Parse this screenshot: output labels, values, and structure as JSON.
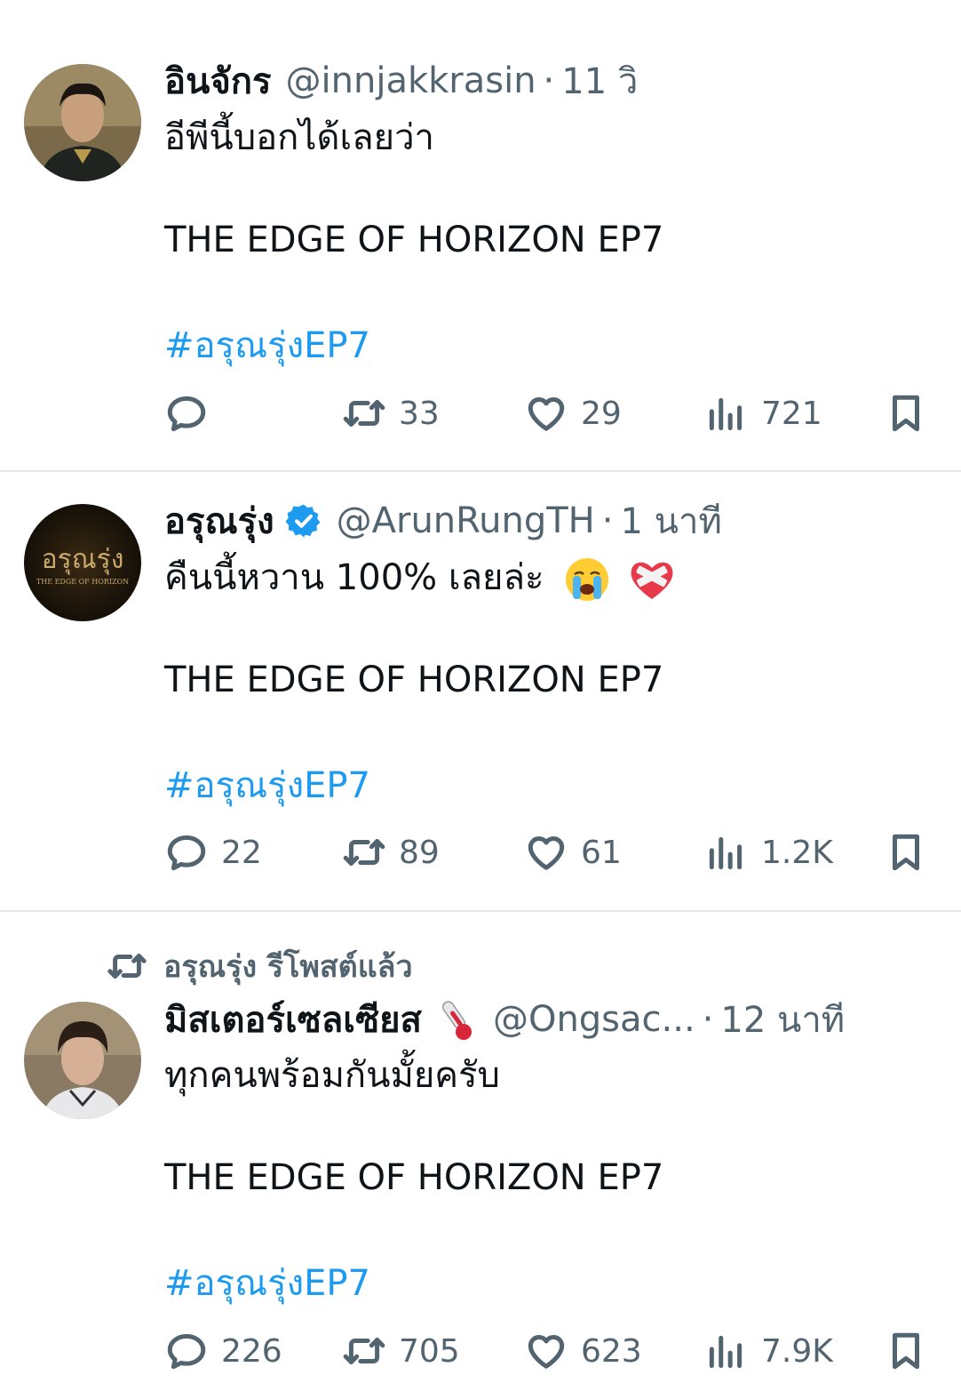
{
  "tweets": [
    {
      "name": "อินจักร",
      "handle": "@innjakkrasin",
      "time": "11 วิ",
      "text1": "อีพีนี้บอกได้เลยว่า",
      "title": "THE EDGE OF HORIZON EP7",
      "hashtag": "#อรุณรุ่งEP7",
      "replies": "",
      "reposts": "33",
      "likes": "29",
      "views": "721"
    },
    {
      "name": "อรุณรุ่ง",
      "verified": true,
      "handle": "@ArunRungTH",
      "time": "1 นาที",
      "text1": "คืนนี้หวาน 100% เลยล่ะ",
      "emoji": [
        "crying-face-emoji",
        "mending-heart-emoji"
      ],
      "title": "THE EDGE OF HORIZON EP7",
      "hashtag": "#อรุณรุ่งEP7",
      "avatar_logo_text": "อรุณรุ่ง",
      "avatar_logo_sub": "THE EDGE OF HORIZON",
      "replies": "22",
      "reposts": "89",
      "likes": "61",
      "views": "1.2K"
    },
    {
      "repost_note": "อรุณรุ่ง รีโพสต์แล้ว",
      "name": "มิสเตอร์เซลเซียส",
      "name_emoji": "thermometer-emoji",
      "handle": "@Ongsac...",
      "time": "12 นาที",
      "text1": "ทุกคนพร้อมกันมั้ยครับ",
      "title": "THE EDGE OF HORIZON EP7",
      "hashtag": "#อรุณรุ่งEP7",
      "replies": "226",
      "reposts": "705",
      "likes": "623",
      "views": "7.9K"
    }
  ],
  "colors": {
    "text": "#0f1419",
    "secondary": "#536471",
    "link": "#1d9bf0",
    "verified": "#1d9bf0",
    "divider": "#e6e6e6"
  }
}
